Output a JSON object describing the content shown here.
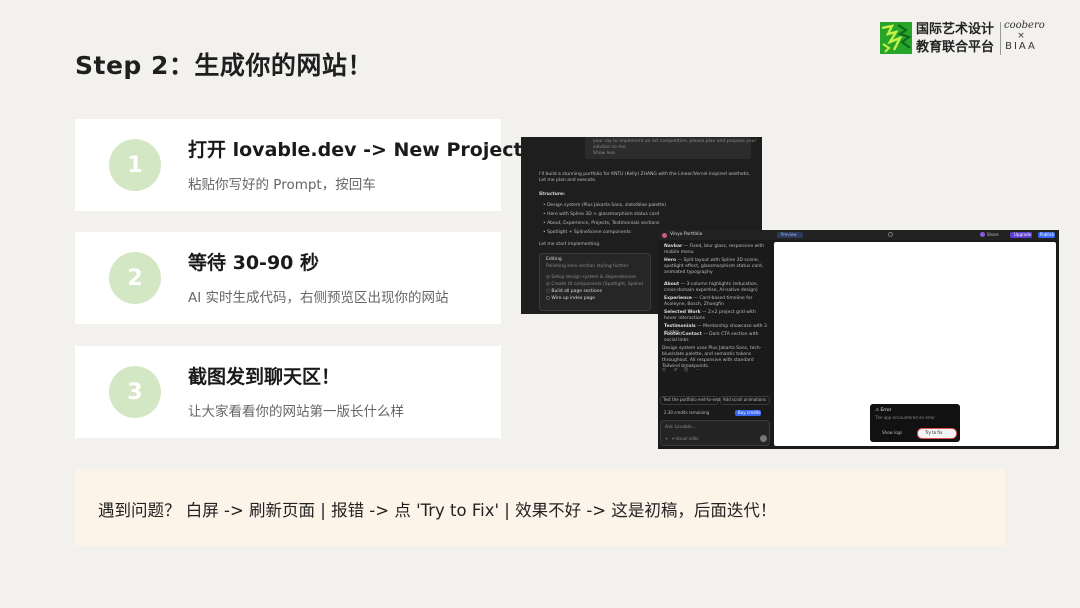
{
  "title": "Step 2：生成你的网站！",
  "logo": {
    "cn_line1": "国际艺术设计",
    "cn_line2": "教育联合平台",
    "brand": "coobero",
    "x": "×",
    "biaa": "BIAA"
  },
  "steps": [
    {
      "number": "1",
      "title": "打开 lovable.dev -> New Project",
      "desc": "粘贴你写好的 Prompt，按回车"
    },
    {
      "number": "2",
      "title": "等待 30-90 秒",
      "desc": "AI 实时生成代码，右侧预览区出现你的网站"
    },
    {
      "number": "3",
      "title": "截图发到聊天区！",
      "desc": "让大家看看你的网站第一版长什么样"
    }
  ],
  "screenshot": {
    "back": {
      "lines_top": [
        "your ray to implement an art competition, please plan and propose your",
        "solution to me."
      ],
      "show_less": "Show less",
      "intro": "I'll build a stunning portfolio for KNTU (Kelly) ZHANG with the Linear/Vercel-inspired aesthetic. Let me plan and execute.",
      "structure_label": "Structure:",
      "structure": [
        "Design system (Plus Jakarta Sans, slate/blue palette)",
        "Hero with Spline 3D + glassmorphism status card",
        "About, Experience, Projects, Testimonials sections",
        "Spotlight + SplineScene components"
      ],
      "start": "Let me start implementing.",
      "panel_title": "Editing",
      "panel_sub": "Polishing hero section styling further",
      "tasks": [
        "Setup design system & dependencies",
        "Create UI components (Spotlight, Spline)",
        "Build all page sections",
        "Wire up index page"
      ]
    },
    "front": {
      "project": "Vinyo Portfolio",
      "toolbar_preview": "Preview",
      "share": "Share",
      "upgrade": "Upgrade",
      "publish": "Publish",
      "items": [
        [
          "Navbar",
          "— Fixed, blur glass, responsive with mobile menu"
        ],
        [
          "Hero",
          "— Split layout with Spline 3D scene, spotlight effect, glassmorphism status card, animated typography"
        ],
        [
          "About",
          "— 3-column highlights (education, cross-domain expertise, AI-native design)"
        ],
        [
          "Experience",
          "— Card-based timeline for Acoleyne, Bosch, Zhongfin"
        ],
        [
          "Selected Work",
          "— 2×2 project grid with hover interactions"
        ],
        [
          "Testimonials",
          "— Mentorship showcase with 3 quotes"
        ],
        [
          "Footer/Contact",
          "— Dark CTA section with social links"
        ]
      ],
      "summary": "Design system uses Plus Jakarta Sans, tech-blue/slate palette, and semantic tokens throughout. All responsive with standard Tailwind breakpoints.",
      "suggestion1": "Test the portfolio end-to-end",
      "suggestion2": "Add scroll animations",
      "credits": "2.30 credits remaining",
      "buy": "Buy credits",
      "ask": "Ask Lovable...",
      "visual_edits": "Visual edits",
      "error_title": "Error",
      "error_msg": "The app encountered an error",
      "show_logs": "Show logs",
      "try_fix": "Try to fix"
    }
  },
  "tip": "遇到问题？  白屏 -> 刷新页面  |  报错 -> 点 'Try to Fix'  |  效果不好 -> 这是初稿，后面迭代！",
  "colors": {
    "accent_green": "#d4e7c5",
    "logo_green": "#2ea62e",
    "tip_bg": "#fdf4e9"
  }
}
